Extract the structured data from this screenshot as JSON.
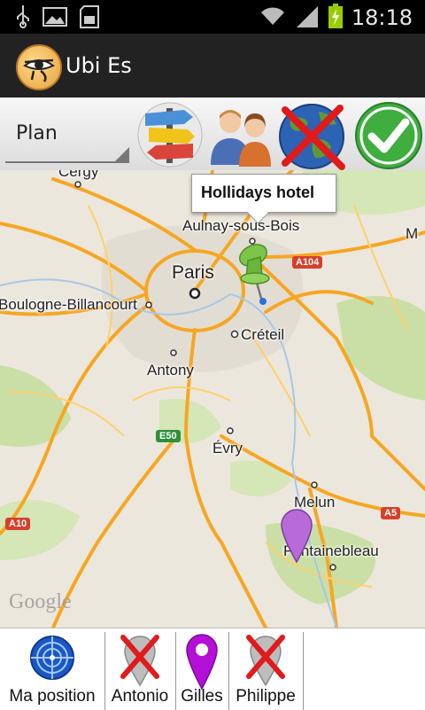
{
  "status_bar": {
    "time": "18:18",
    "icons": [
      "usb-icon",
      "image-icon",
      "sd-card-icon",
      "wifi-icon",
      "signal-icon",
      "battery-charging-icon"
    ]
  },
  "app": {
    "title": "Ubi Es",
    "icon": "eye-of-horus-icon"
  },
  "toolbar": {
    "map_type": "Plan",
    "buttons": [
      "signpost-icon",
      "users-icon",
      "globe-cancel-icon",
      "checkmark-icon"
    ]
  },
  "map": {
    "callout": "Hollidays hotel",
    "places": {
      "cergy": "Cergy",
      "aulnay": "Aulnay-sous-Bois",
      "paris": "Paris",
      "boulogne": "Boulogne-Billancourt",
      "creteil": "Créteil",
      "antony": "Antony",
      "evry": "Évry",
      "melun": "Melun",
      "fontainebleau": "Fontainebleau",
      "m": "M"
    },
    "roads": {
      "a104": "A104",
      "e50": "E50",
      "a10": "A10",
      "a5": "A5"
    },
    "attribution": "Google",
    "colors": {
      "background": "#ece7dc",
      "highway": "#f6a623",
      "green": "#c9dfa6",
      "road_shield": "#d6402b",
      "euro_shield": "#2f8f3a"
    }
  },
  "bottom_tabs": [
    {
      "label": "Ma position",
      "icon": "target-icon"
    },
    {
      "label": "Antonio",
      "icon": "cancelled-pin-icon"
    },
    {
      "label": "Gilles",
      "icon": "location-pin-icon"
    },
    {
      "label": "Philippe",
      "icon": "cancelled-pin-icon"
    }
  ]
}
